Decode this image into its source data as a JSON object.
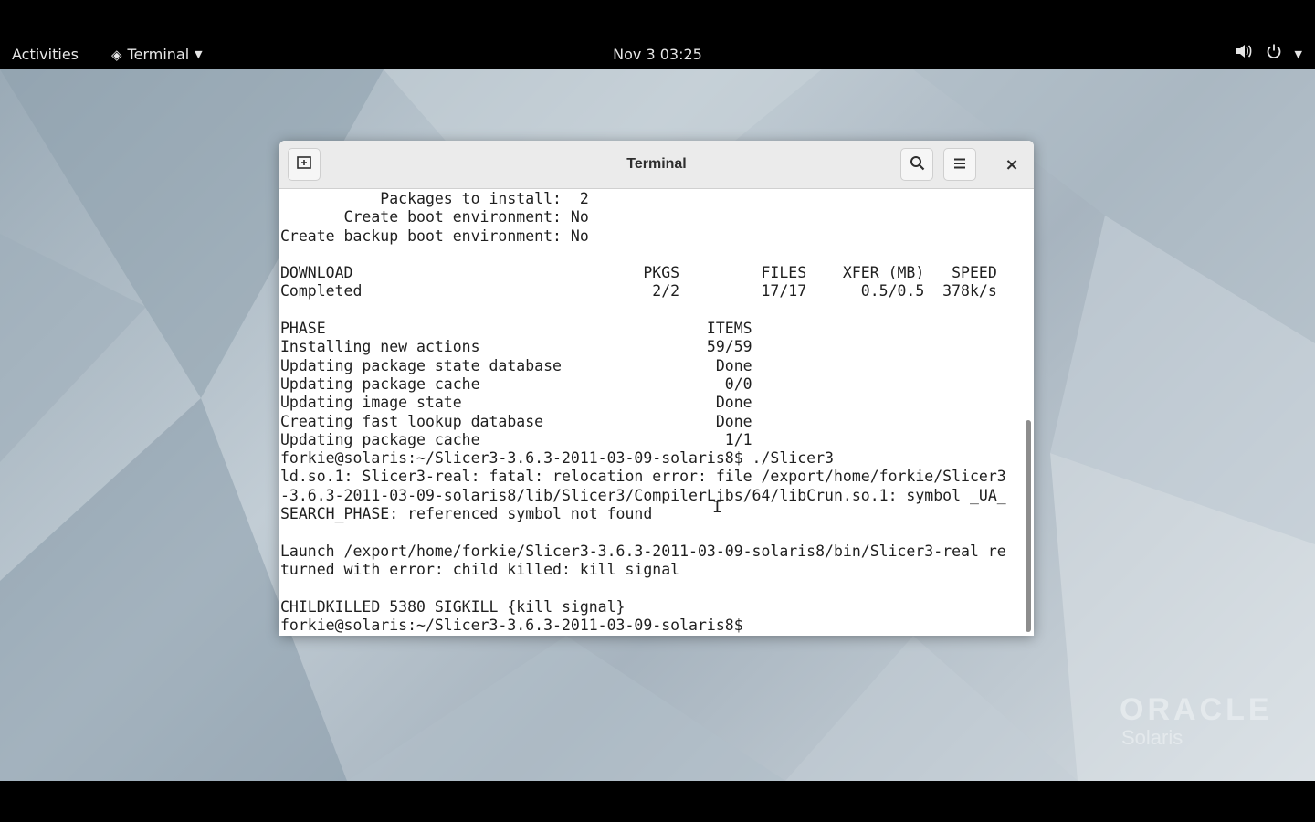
{
  "topbar": {
    "activities": "Activities",
    "app_name": "Terminal",
    "app_icon": "terminal-diamond-icon",
    "clock": "Nov 3  03:25",
    "tray_icons": [
      "volume-icon",
      "power-icon",
      "chevron-down-icon"
    ]
  },
  "window": {
    "title": "Terminal",
    "buttons": {
      "new_tab": "new-tab-icon",
      "search": "search-icon",
      "menu": "hamburger-menu-icon",
      "close": "×"
    }
  },
  "terminal": {
    "lines": [
      "           Packages to install:  2",
      "       Create boot environment: No",
      "Create backup boot environment: No",
      "",
      "DOWNLOAD                                PKGS         FILES    XFER (MB)   SPEED",
      "Completed                                2/2         17/17      0.5/0.5  378k/s",
      "",
      "PHASE                                          ITEMS",
      "Installing new actions                         59/59",
      "Updating package state database                 Done",
      "Updating package cache                           0/0",
      "Updating image state                            Done",
      "Creating fast lookup database                   Done",
      "Updating package cache                           1/1",
      "forkie@solaris:~/Slicer3-3.6.3-2011-03-09-solaris8$ ./Slicer3",
      "ld.so.1: Slicer3-real: fatal: relocation error: file /export/home/forkie/Slicer3",
      "-3.6.3-2011-03-09-solaris8/lib/Slicer3/CompilerLibs/64/libCrun.so.1: symbol _UA_",
      "SEARCH_PHASE: referenced symbol not found",
      "",
      "Launch /export/home/forkie/Slicer3-3.6.3-2011-03-09-solaris8/bin/Slicer3-real re",
      "turned with error: child killed: kill signal",
      "",
      "CHILDKILLED 5380 SIGKILL {kill signal}",
      "forkie@solaris:~/Slicer3-3.6.3-2011-03-09-solaris8$ "
    ]
  },
  "desktop": {
    "logo_brand": "ORACLE",
    "logo_product": "Solaris"
  },
  "colors": {
    "topbar_bg": "#000000",
    "titlebar_bg": "#ebebeb",
    "terminal_bg": "#ffffff",
    "terminal_fg": "#1f1f1f",
    "wallpaper": "#b4c1ca"
  }
}
